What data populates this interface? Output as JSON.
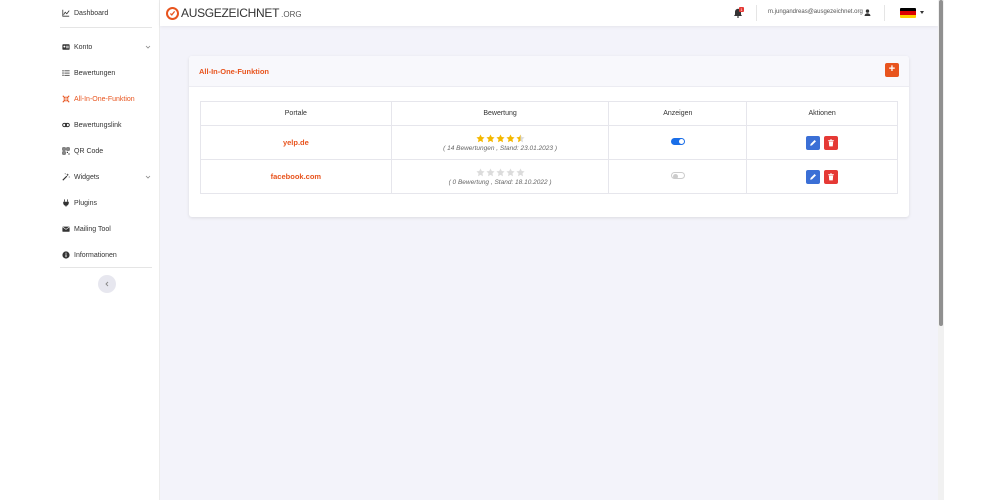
{
  "sidebar": {
    "items": [
      {
        "label": "Dashboard",
        "icon": "chart-line-icon"
      },
      {
        "label": "Konto",
        "icon": "id-card-icon"
      },
      {
        "label": "Bewertungen",
        "icon": "list-icon"
      },
      {
        "label": "All-In-One-Funktion",
        "icon": "compress-arrows-icon"
      },
      {
        "label": "Bewertungslink",
        "icon": "link-icon"
      },
      {
        "label": "QR Code",
        "icon": "qrcode-icon"
      },
      {
        "label": "Widgets",
        "icon": "magic-wand-icon"
      },
      {
        "label": "Plugins",
        "icon": "plug-icon"
      },
      {
        "label": "Mailing Tool",
        "icon": "envelope-icon"
      },
      {
        "label": "Informationen",
        "icon": "info-circle-icon"
      }
    ],
    "active_index": 3
  },
  "header": {
    "logo_text": "AUSGEZEICHNET",
    "logo_tld": ".ORG",
    "notification_count": "1",
    "user_email": "m.jungandreas@ausgezeichnet.org"
  },
  "card": {
    "title": "All-In-One-Funktion",
    "add_label": "+"
  },
  "table": {
    "headers": [
      "Portale",
      "Bewertung",
      "Anzeigen",
      "Aktionen"
    ],
    "rows": [
      {
        "portal": "yelp.de",
        "stars": 4.5,
        "rating_text": "( 14 Bewertungen , Stand: 23.01.2023 )",
        "shown": true
      },
      {
        "portal": "facebook.com",
        "stars": 0,
        "rating_text": "( 0 Bewertung , Stand: 18.10.2022 )",
        "shown": false
      }
    ]
  },
  "colors": {
    "accent": "#e8541e",
    "toggle_on": "#1a6ee8",
    "edit": "#3b6fd6",
    "delete": "#e53935",
    "star": "#f5b800",
    "star_empty": "#dcdcdc"
  }
}
